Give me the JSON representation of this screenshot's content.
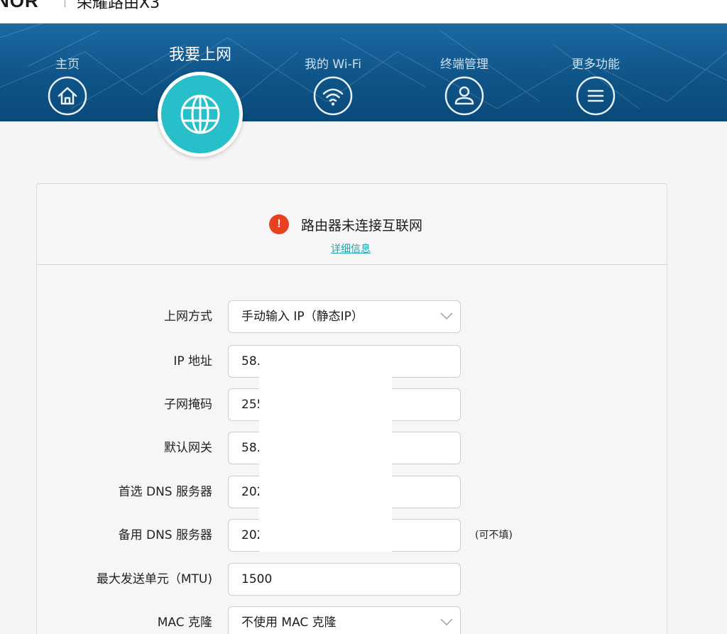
{
  "brand": {
    "logo": "NOR",
    "title": "荣耀路由X3"
  },
  "nav": {
    "items": [
      {
        "label": "主页",
        "icon": "home-icon"
      },
      {
        "label": "我要上网",
        "icon": "globe-icon"
      },
      {
        "label": "我的 Wi-Fi",
        "icon": "wifi-icon"
      },
      {
        "label": "终端管理",
        "icon": "user-icon"
      },
      {
        "label": "更多功能",
        "icon": "menu-icon"
      }
    ],
    "active_index": 1
  },
  "status": {
    "message": "路由器未连接互联网",
    "details_link": "详细信息"
  },
  "form": {
    "connection_type": {
      "label": "上网方式",
      "value": "手动输入 IP（静态IP）"
    },
    "ip_address": {
      "label": "IP 地址",
      "value": "58."
    },
    "subnet_mask": {
      "label": "子网掩码",
      "value": "255"
    },
    "default_gateway": {
      "label": "默认网关",
      "value": "58."
    },
    "primary_dns": {
      "label": "首选 DNS 服务器",
      "value": "202"
    },
    "secondary_dns": {
      "label": "备用 DNS 服务器",
      "value": "202",
      "hint": "(可不填)"
    },
    "mtu": {
      "label": "最大发送单元（MTU)",
      "value": "1500"
    },
    "mac_clone": {
      "label": "MAC 克隆",
      "value": "不使用 MAC 克隆"
    }
  },
  "colors": {
    "nav_blue": "#0f5488",
    "active_teal": "#27bfc9",
    "alert_red": "#e8411f",
    "link_teal": "#1fa6b3"
  }
}
